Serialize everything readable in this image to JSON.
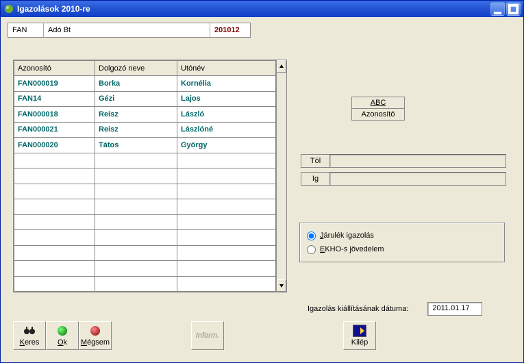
{
  "window": {
    "title": "Igazolások 2010-re"
  },
  "top": {
    "code": "FAN",
    "company": "Adó Bt",
    "period": "201012"
  },
  "grid": {
    "columns": [
      "Azonosító",
      "Dolgozó neve",
      "Utónév"
    ],
    "rows": [
      {
        "id": "FAN000019",
        "surname": "Borka",
        "given": "Kornélia"
      },
      {
        "id": "FAN14",
        "surname": "Gézi",
        "given": "Lajos"
      },
      {
        "id": "FAN000018",
        "surname": "Reisz",
        "given": "László"
      },
      {
        "id": "FAN000021",
        "surname": "Reisz",
        "given": "Lászlóné"
      },
      {
        "id": "FAN000020",
        "surname": "Tátos",
        "given": "György"
      }
    ],
    "visible_rows": 14
  },
  "sort": {
    "abc": "ABC",
    "azonosito": "Azonosító"
  },
  "range": {
    "from_label": "Tól",
    "to_label": "Ig",
    "from": "",
    "to": ""
  },
  "radios": {
    "jarulek": {
      "label_pre": "J",
      "label_rest": "árulék igazolás",
      "checked": true
    },
    "ekho": {
      "label_pre": "E",
      "label_rest": "KHO-s jövedelem",
      "checked": false
    }
  },
  "date": {
    "label": "Igazolás kiállításának dátuma:",
    "value": "2011.01.17"
  },
  "toolbar": {
    "keres_pre": "K",
    "keres_rest": "eres",
    "ok_pre": "O",
    "ok_rest": "k",
    "megsem_pre": "M",
    "megsem_rest": "égsem",
    "inform": "Inform.",
    "kilep_pre": "K",
    "kilep_rest": "ilép"
  }
}
